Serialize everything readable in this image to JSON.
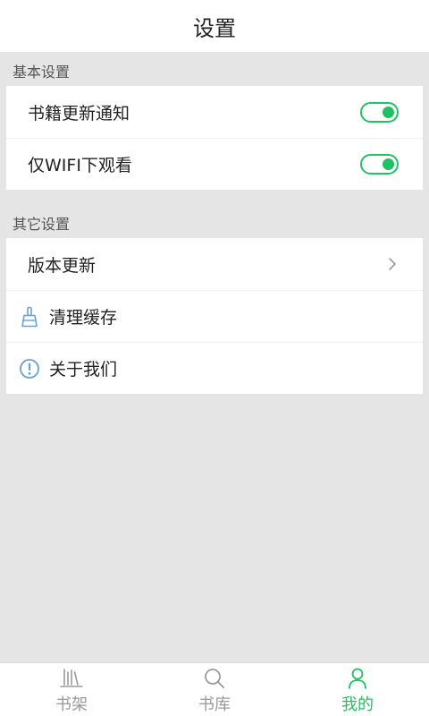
{
  "header": {
    "title": "设置"
  },
  "sections": {
    "basic": {
      "label": "基本设置",
      "items": [
        {
          "label": "书籍更新通知",
          "toggle_on": true
        },
        {
          "label": "仅WIFI下观看",
          "toggle_on": true
        }
      ]
    },
    "other": {
      "label": "其它设置",
      "items": [
        {
          "label": "版本更新",
          "icon": "chevron-right-icon"
        },
        {
          "label": "清理缓存",
          "icon": "broom-icon"
        },
        {
          "label": "关于我们",
          "icon": "info-circle-icon"
        }
      ]
    }
  },
  "tabbar": {
    "items": [
      {
        "label": "书架",
        "icon": "bookshelf-icon",
        "active": false
      },
      {
        "label": "书库",
        "icon": "search-icon",
        "active": false
      },
      {
        "label": "我的",
        "icon": "user-icon",
        "active": true
      }
    ]
  },
  "colors": {
    "accent": "#22c064",
    "background": "#e5e5e5",
    "icon_blue": "#6a9fd0",
    "tab_inactive": "#9a9a9a"
  }
}
